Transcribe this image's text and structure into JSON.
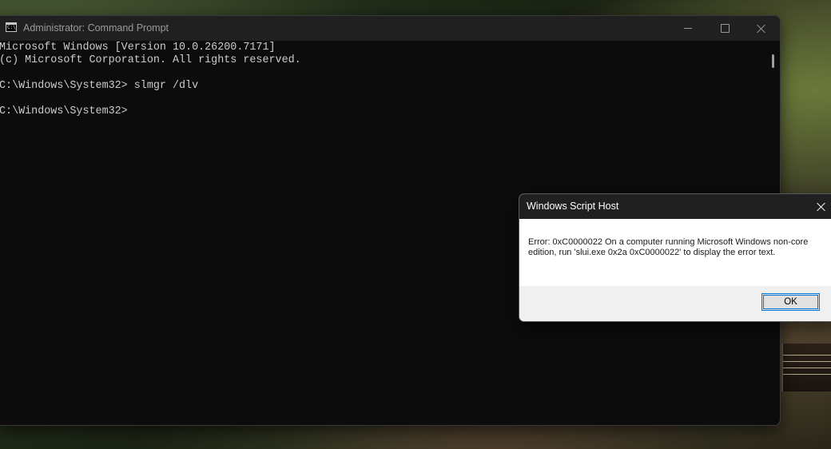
{
  "console_window": {
    "title": "Administrator: Command Prompt",
    "icon": "cmd-icon",
    "icon_text": "C:\\",
    "lines": [
      "Microsoft Windows [Version 10.0.26200.7171]",
      "(c) Microsoft Corporation. All rights reserved.",
      "",
      "C:\\Windows\\System32> slmgr /dlv",
      "",
      "C:\\Windows\\System32>"
    ],
    "background_color": "#0c0c0c",
    "text_color": "#cccccc"
  },
  "dialog": {
    "title": "Windows Script Host",
    "message": "Error: 0xC0000022 On a computer running Microsoft Windows non-core edition, run 'slui.exe 0x2a 0xC0000022' to display the error text.",
    "ok_label": "OK",
    "accent_color": "#0078d7"
  }
}
